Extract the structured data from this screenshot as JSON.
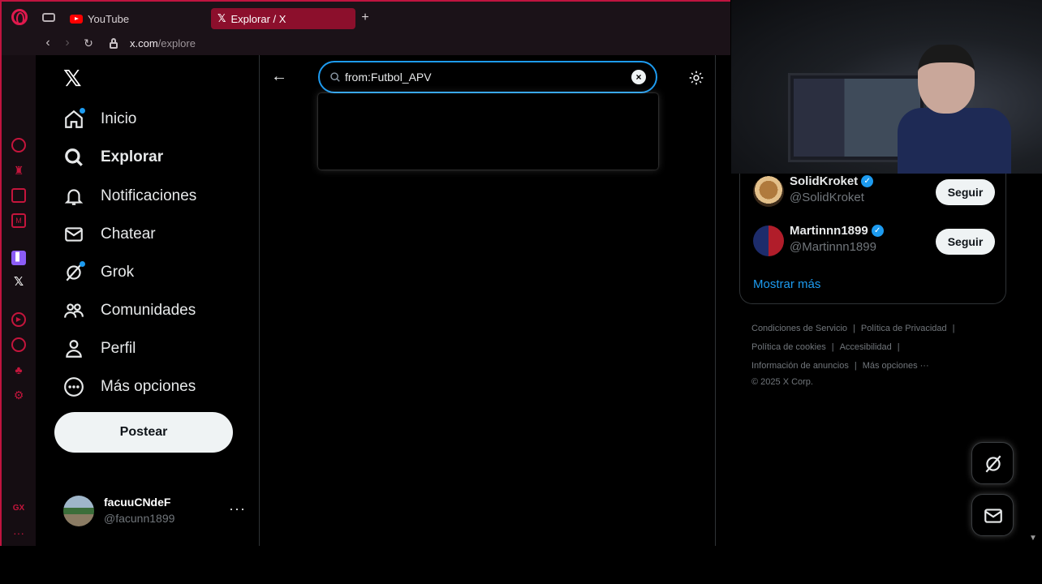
{
  "browser": {
    "tabs": [
      {
        "label": "YouTube"
      },
      {
        "label": "Explorar / X"
      }
    ],
    "new_tab": "+",
    "address": {
      "domain": "x.com",
      "path": "/explore"
    }
  },
  "sidebar": {
    "items": [
      {
        "label": "Inicio",
        "icon": "home-icon"
      },
      {
        "label": "Explorar",
        "icon": "search-icon"
      },
      {
        "label": "Notificaciones",
        "icon": "bell-icon"
      },
      {
        "label": "Chatear",
        "icon": "mail-icon"
      },
      {
        "label": "Grok",
        "icon": "grok-icon"
      },
      {
        "label": "Comunidades",
        "icon": "people-icon"
      },
      {
        "label": "Perfil",
        "icon": "person-icon"
      },
      {
        "label": "Más opciones",
        "icon": "more-circle-icon"
      }
    ],
    "post_label": "Postear",
    "account": {
      "name": "facuuCNdeF",
      "handle": "@facunn1899",
      "more": "···"
    }
  },
  "search": {
    "value": "from:Futbol_APV"
  },
  "who_to_follow": [
    {
      "name": "SolidKroket",
      "handle": "@SolidKroket",
      "button": "Seguir"
    },
    {
      "name": "Martinnn1899",
      "handle": "@Martinnn1899",
      "button": "Seguir"
    }
  ],
  "show_more": "Mostrar más",
  "footer": {
    "links": [
      "Condiciones de Servicio",
      "Política de Privacidad",
      "Política de cookies",
      "Accesibilidad",
      "Información de anuncios",
      "Más opciones ···"
    ],
    "copyright": "© 2025 X Corp."
  },
  "opera_sidebar": {
    "gx_label": "GX",
    "more": "···"
  },
  "colors": {
    "accent": "#1d9bf0",
    "opera_red": "#c0143f",
    "background": "#000000"
  }
}
